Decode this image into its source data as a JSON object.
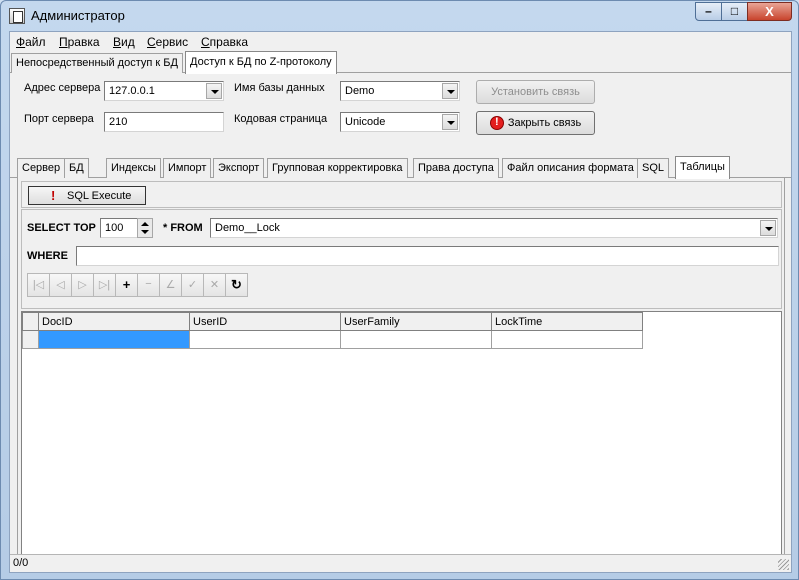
{
  "window": {
    "title": "Администратор"
  },
  "caption": {
    "minimize": "–",
    "maximize": "□",
    "close": "X"
  },
  "menu": [
    {
      "label": "Файл",
      "underline": "Ф",
      "rest": "айл"
    },
    {
      "label": "Правка",
      "underline": "П",
      "rest": "равка"
    },
    {
      "label": "Вид",
      "underline": "В",
      "rest": "ид"
    },
    {
      "label": "Сервис",
      "underline": "С",
      "rest": "ервис"
    },
    {
      "label": "Справка",
      "underline": "С",
      "rest": "правка"
    }
  ],
  "access_tabs": {
    "direct": "Непосредственный доступ к БД",
    "zprotocol": "Доступ к БД по Z-протоколу",
    "active": "zprotocol"
  },
  "connection": {
    "server_address_label": "Адрес сервера",
    "server_address": "127.0.0.1",
    "server_port_label": "Порт сервера",
    "server_port": "210",
    "db_name_label": "Имя базы данных",
    "db_name": "Demo",
    "codepage_label": "Кодовая страница",
    "codepage": "Unicode",
    "connect_button": "Установить связь",
    "disconnect_button": "Закрыть связь"
  },
  "tabs": {
    "server": "Сервер",
    "db": "БД",
    "indexes": "Индексы",
    "import": "Импорт",
    "export": "Экспорт",
    "group_edit": "Групповая корректировка",
    "access_rights": "Права доступа",
    "format_file": "Файл описания формата",
    "sql": "SQL",
    "tables": "Таблицы",
    "active": "tables"
  },
  "sql_toolbar": {
    "execute_button": "SQL Execute"
  },
  "query": {
    "select_top_label": "SELECT TOP",
    "top_value": "100",
    "from_label": "* FROM",
    "table": "Demo__Lock",
    "where_label": "WHERE",
    "where_value": ""
  },
  "navigator": {
    "first": "|◁",
    "prior": "◁",
    "next": "▷",
    "last": "▷|",
    "insert": "+",
    "delete": "−",
    "edit": "∠",
    "post": "✓",
    "cancel": "✕",
    "refresh": "↻"
  },
  "grid": {
    "columns": [
      "DocID",
      "UserID",
      "UserFamily",
      "LockTime"
    ],
    "rows": [
      [
        "",
        "",
        "",
        ""
      ]
    ]
  },
  "status": {
    "text": "0/0"
  }
}
